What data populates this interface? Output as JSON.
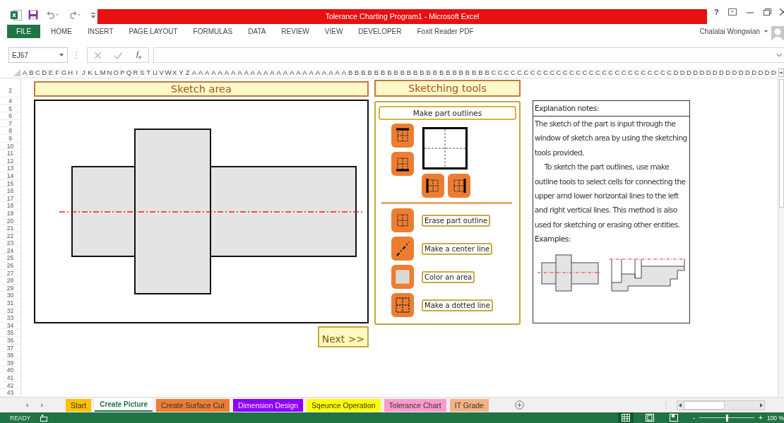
{
  "window": {
    "title": "Tolerance Charting Program1 - Microsoft Excel",
    "help": "?"
  },
  "ribbon": {
    "tabs": [
      {
        "label": "FILE",
        "kind": "file"
      },
      {
        "label": "HOME",
        "kind": "tab"
      },
      {
        "label": "INSERT",
        "kind": "tab"
      },
      {
        "label": "PAGE LAYOUT",
        "kind": "tab"
      },
      {
        "label": "FORMULAS",
        "kind": "tab"
      },
      {
        "label": "DATA",
        "kind": "tab"
      },
      {
        "label": "REVIEW",
        "kind": "tab"
      },
      {
        "label": "VIEW",
        "kind": "tab"
      },
      {
        "label": "DEVELOPER",
        "kind": "tab"
      },
      {
        "label": "Foxit Reader PDF",
        "kind": "tab"
      }
    ],
    "user": "Chalalai Wongwian"
  },
  "formula_bar": {
    "name_box": "EJ67",
    "function_label": "f$_{x}$"
  },
  "grid": {
    "column_headers": [
      "A",
      "B",
      "C",
      "D",
      "E",
      "F",
      "G",
      "H",
      "I",
      "J",
      "K",
      "L",
      "M",
      "N",
      "O",
      "P",
      "Q",
      "R",
      "S",
      "T",
      "U",
      "V",
      "W",
      "X",
      "Y",
      "Z",
      "A",
      "A",
      "A",
      "A",
      "A",
      "A",
      "A",
      "A",
      "A",
      "A",
      "A",
      "A",
      "A",
      "A",
      "A",
      "A",
      "A",
      "A",
      "A",
      "A",
      "A",
      "A",
      "A",
      "A",
      "B",
      "B",
      "B",
      "B",
      "B",
      "B",
      "B",
      "B",
      "B",
      "B",
      "B",
      "B",
      "B",
      "B",
      "B",
      "B",
      "B",
      "B",
      "B",
      "B",
      "B",
      "B",
      "C",
      "C",
      "C",
      "C",
      "C",
      "C",
      "C",
      "C",
      "C",
      "C",
      "C",
      "C",
      "C",
      "C",
      "C",
      "C",
      "C",
      "C",
      "C",
      "C",
      "C",
      "C",
      "C",
      "C",
      "C",
      "C",
      "C",
      "C",
      "D",
      "D",
      "D",
      "D",
      "D",
      "D",
      "D",
      "D",
      "D",
      "D",
      "D",
      "D",
      "D",
      "D",
      "D",
      "D"
    ],
    "row_headers": [
      "2",
      "4",
      "5",
      "6",
      "7",
      "8",
      "9",
      "10",
      "11",
      "12",
      "13",
      "14",
      "15",
      "16",
      "17",
      "18",
      "19",
      "20",
      "21",
      "22",
      "23",
      "24",
      "25",
      "26",
      "27",
      "28",
      "29",
      "30",
      "31",
      "32",
      "33",
      "34",
      "35",
      "36",
      "37",
      "38",
      "39",
      "40",
      "41",
      "42",
      "43"
    ]
  },
  "sketch_area": {
    "title": "Sketch area",
    "next_button": "Next >>"
  },
  "sketching_tools": {
    "title": "Sketching tools",
    "outline_button": "Make part outlines",
    "tools": [
      {
        "label": "Erase part outline"
      },
      {
        "label": "Make a center line"
      },
      {
        "label": "Color an area"
      },
      {
        "label": "Make a dotted line"
      }
    ]
  },
  "explanation": {
    "title": "Explanation notes:",
    "paragraphs": [
      "The sketch of the part is input through the window of sketch area by using the sketching tools provided.",
      "To sketch the part outlines, use make outline tools to select cells for connecting the upper amd lower horizontal lines to the left and right vertical lines. This method is also used for sketching or erasing other entities."
    ],
    "examples_label": "Examples:"
  },
  "sheet_tabs": [
    {
      "label": "Start",
      "color": "#ffc000",
      "selected": false
    },
    {
      "label": "Create Picture",
      "color": "#ffffff",
      "selected": true
    },
    {
      "label": "Create Surface Cut",
      "color": "#ed7d31",
      "selected": false
    },
    {
      "label": "Dimension Design",
      "color": "#8c00ff",
      "selected": false
    },
    {
      "label": "Sqeunce Operation",
      "color": "#ffff00",
      "selected": false
    },
    {
      "label": "Tolerance Chart",
      "color": "#ff99cc",
      "selected": false
    },
    {
      "label": "IT Grade",
      "color": "#f4b183",
      "selected": false
    }
  ],
  "status_bar": {
    "status": "READY",
    "views": [
      {
        "selected": true
      },
      {
        "selected": false
      },
      {
        "selected": false
      }
    ],
    "zoom_out": "-",
    "zoom_slider": {
      "level": 0.5
    },
    "zoom_in": "+",
    "zoom": "100 %"
  }
}
